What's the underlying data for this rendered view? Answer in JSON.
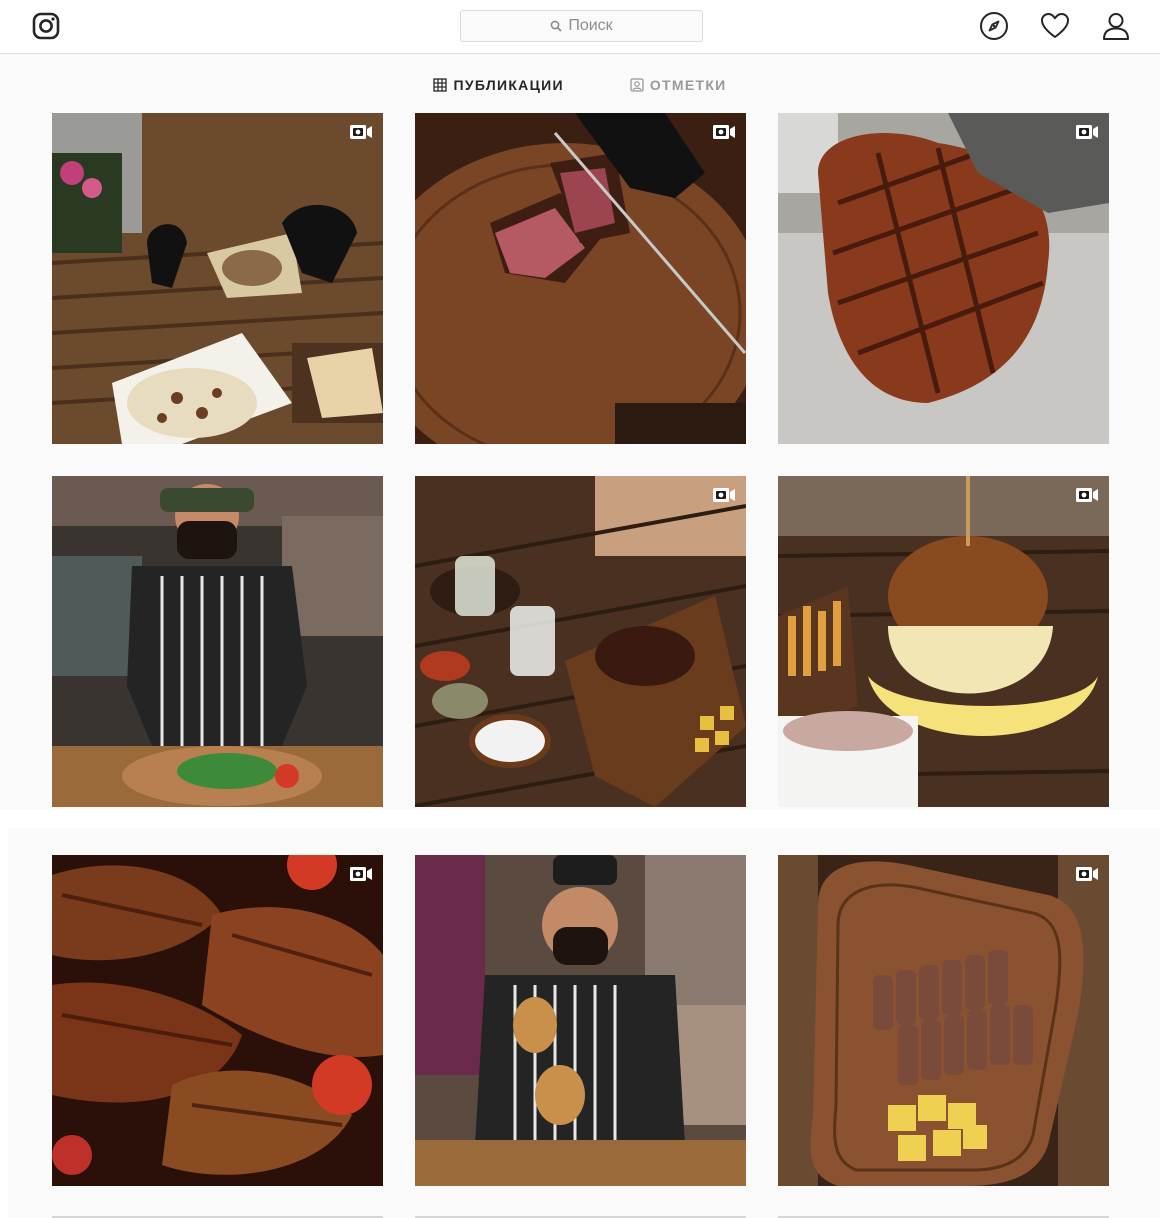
{
  "header": {
    "search_placeholder": "Поиск",
    "logo_icon": "instagram-logo-icon",
    "nav_icons": [
      "compass-icon",
      "heart-icon",
      "profile-icon"
    ]
  },
  "tabs": [
    {
      "label": "ПУБЛИКАЦИИ",
      "icon": "grid-icon",
      "active": true
    },
    {
      "label": "ОТМЕТКИ",
      "icon": "tagged-icon",
      "active": false
    }
  ],
  "posts": [
    {
      "subject": "shawarma-wrap-on-wooden-table",
      "video": true
    },
    {
      "subject": "slicing-steak-on-board",
      "video": true
    },
    {
      "subject": "grilled-steak-held-with-tongs",
      "video": true
    },
    {
      "subject": "chef-with-salad-board",
      "video": false
    },
    {
      "subject": "steak-with-drinks-and-spices",
      "video": true
    },
    {
      "subject": "cheese-burger-with-fries",
      "video": true
    },
    {
      "subject": "grilled-steaks-close-up",
      "video": true
    },
    {
      "subject": "chef-holding-sandwich",
      "video": false
    },
    {
      "subject": "sliced-meat-with-pineapple",
      "video": true
    }
  ],
  "colors": {
    "background": "#fafafa",
    "border": "#dbdbdb",
    "text_primary": "#262626",
    "text_muted": "#999999"
  }
}
